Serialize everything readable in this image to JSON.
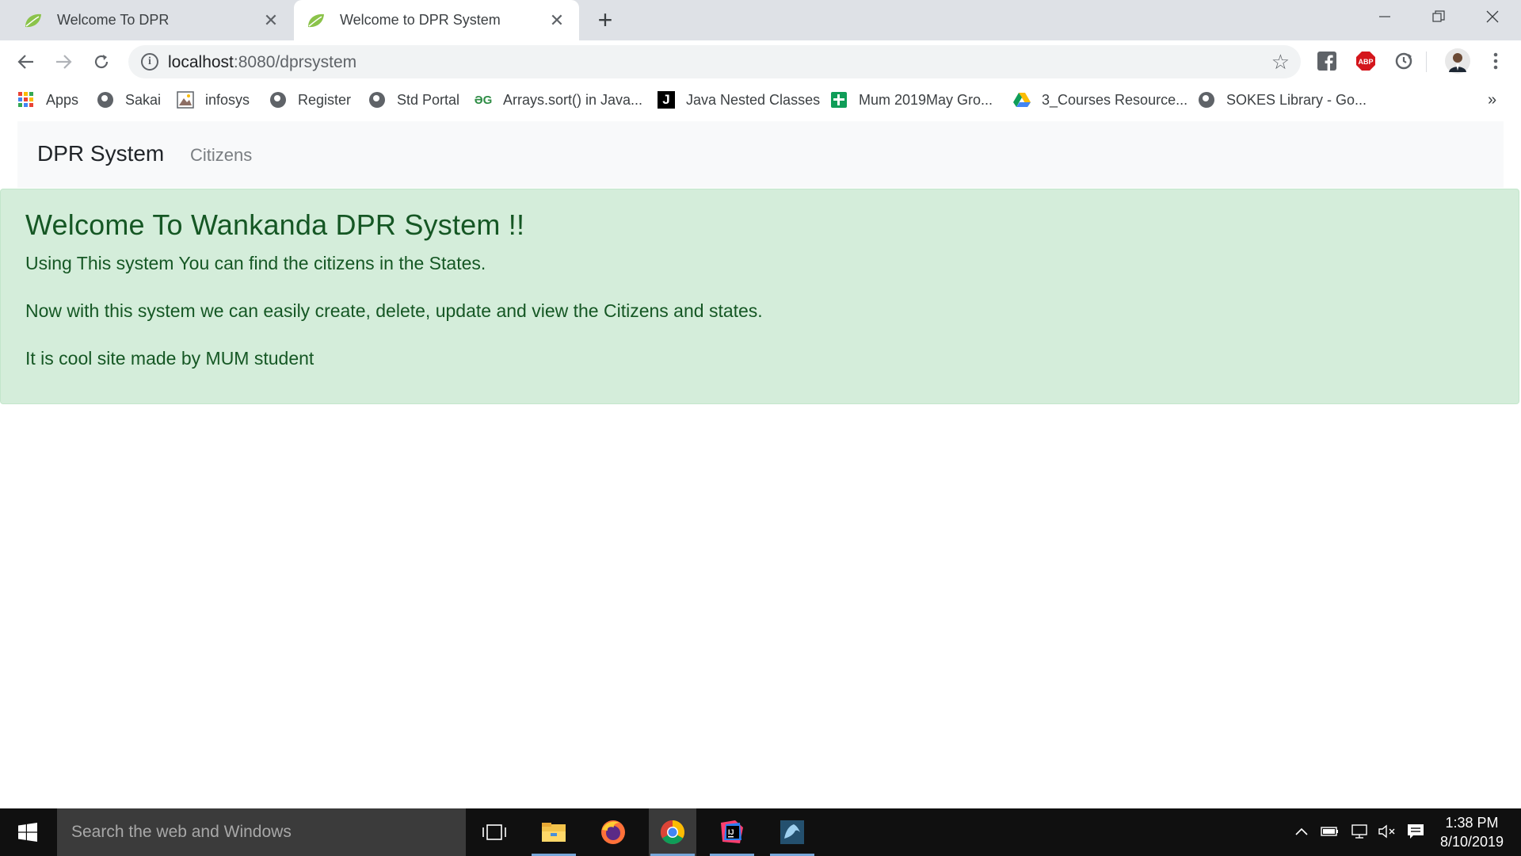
{
  "browser": {
    "tabs": [
      {
        "title": "Welcome To DPR",
        "favicon": "spring-leaf-icon",
        "active": false
      },
      {
        "title": "Welcome to DPR System",
        "favicon": "spring-leaf-icon",
        "active": true
      }
    ],
    "new_tab_label": "+",
    "address": {
      "host": "localhost",
      "path": ":8080/dprsystem"
    },
    "extensions": [
      "facebook-icon",
      "adblock-plus-icon",
      "sync-extension-icon",
      "profile-avatar",
      "menu-icon"
    ],
    "adblock_label": "ABP",
    "bookmarks": [
      {
        "label": "Apps",
        "icon": "apps-grid-icon"
      },
      {
        "label": "Sakai",
        "icon": "globe-icon"
      },
      {
        "label": "infosys",
        "icon": "image-icon"
      },
      {
        "label": "Register",
        "icon": "globe-icon"
      },
      {
        "label": "Std Portal",
        "icon": "globe-icon"
      },
      {
        "label": "Arrays.sort() in Java...",
        "icon": "geeksforgeeks-icon"
      },
      {
        "label": "Java Nested Classes",
        "icon": "j-icon"
      },
      {
        "label": "Mum 2019May Gro...",
        "icon": "sheets-icon"
      },
      {
        "label": "3_Courses Resource...",
        "icon": "drive-icon"
      },
      {
        "label": "SOKES Library - Go...",
        "icon": "globe-icon"
      }
    ],
    "bookmarks_overflow": "»"
  },
  "page": {
    "navbar": {
      "brand": "DPR System",
      "links": [
        "Citizens"
      ]
    },
    "alert": {
      "heading": "Welcome To Wankanda DPR System !!",
      "paragraphs": [
        "Using This system You can find the citizens in the States.",
        "Now with this system we can easily create, delete, update and view the Citizens and states.",
        "It is cool site made by MUM student"
      ]
    }
  },
  "taskbar": {
    "search_placeholder": "Search the web and Windows",
    "apps": [
      "task-view-icon",
      "file-explorer-icon",
      "firefox-icon",
      "chrome-icon",
      "intellij-icon",
      "mysql-workbench-icon"
    ],
    "time": "1:38 PM",
    "date": "8/10/2019"
  },
  "colors": {
    "alert_bg": "#d4edda",
    "alert_text": "#155724",
    "navbar_bg": "#f8f9fa",
    "tabstrip_bg": "#dee1e6"
  }
}
